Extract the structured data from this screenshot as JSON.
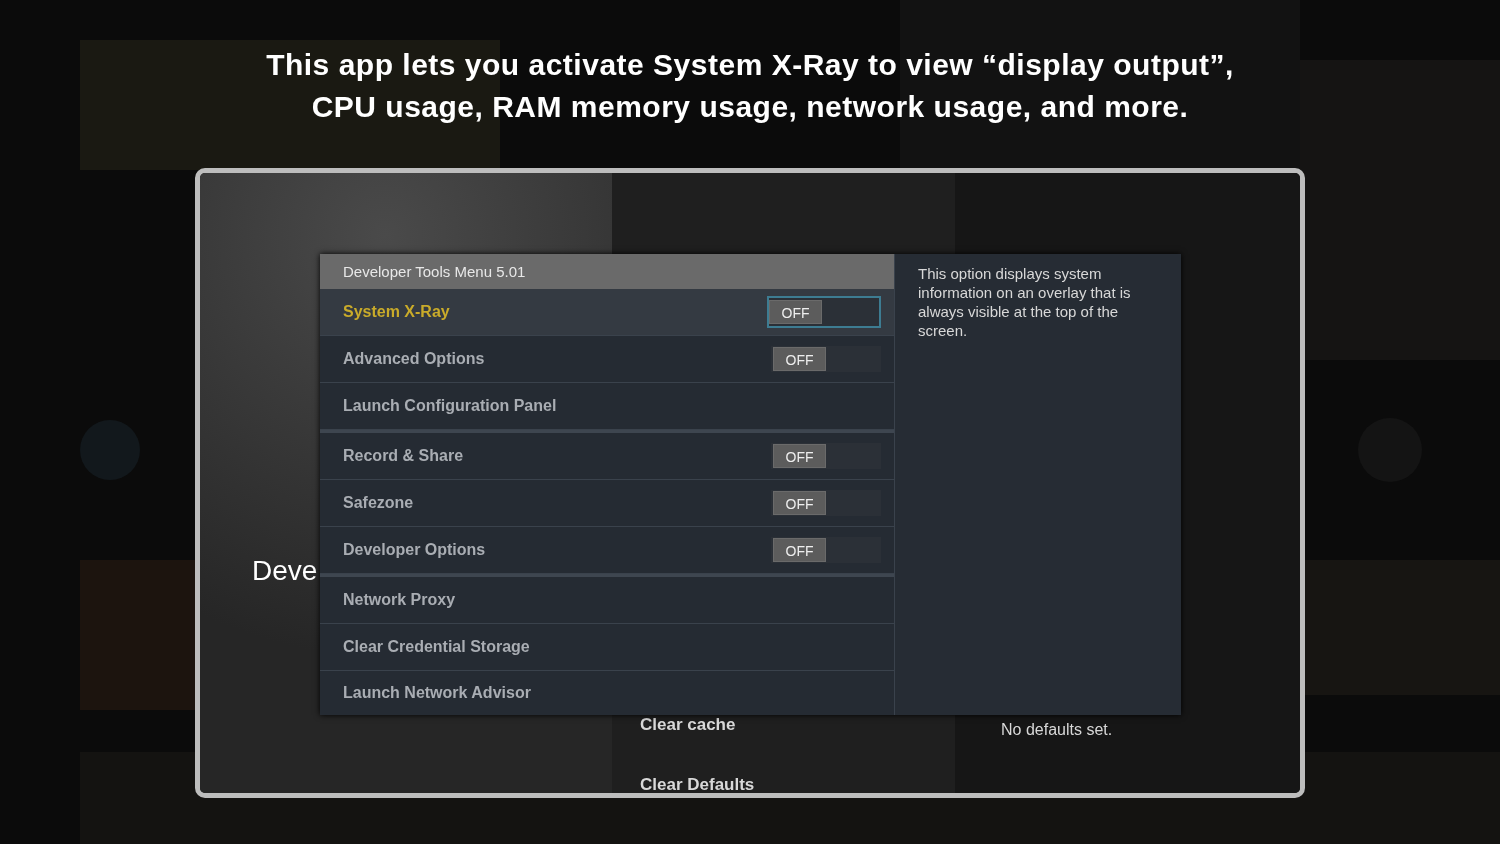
{
  "caption": [
    "This app lets you activate System X-Ray to view “display output”,",
    "CPU usage, RAM memory usage, network usage, and more."
  ],
  "screen": {
    "page_title": "Deve",
    "column_2": [
      "Clear cache",
      "Clear Defaults"
    ],
    "column_3": [
      "No defaults set."
    ]
  },
  "menu": {
    "title": "Developer Tools Menu 5.01",
    "groups": [
      [
        {
          "label": "System X-Ray",
          "kind": "toggle",
          "value": "OFF",
          "selected": true
        },
        {
          "label": "Advanced Options",
          "kind": "toggle",
          "value": "OFF",
          "selected": false
        },
        {
          "label": "Launch Configuration Panel",
          "kind": "action",
          "selected": false
        }
      ],
      [
        {
          "label": "Record & Share",
          "kind": "toggle",
          "value": "OFF",
          "selected": false
        },
        {
          "label": "Safezone",
          "kind": "toggle",
          "value": "OFF",
          "selected": false
        },
        {
          "label": "Developer Options",
          "kind": "toggle",
          "value": "OFF",
          "selected": false
        }
      ],
      [
        {
          "label": "Network Proxy",
          "kind": "action",
          "selected": false
        },
        {
          "label": "Clear Credential Storage",
          "kind": "action",
          "selected": false
        },
        {
          "label": "Launch Network Advisor",
          "kind": "action",
          "selected": false
        }
      ]
    ],
    "description": "This option displays system information on an overlay that is always visible at the top of the screen."
  }
}
